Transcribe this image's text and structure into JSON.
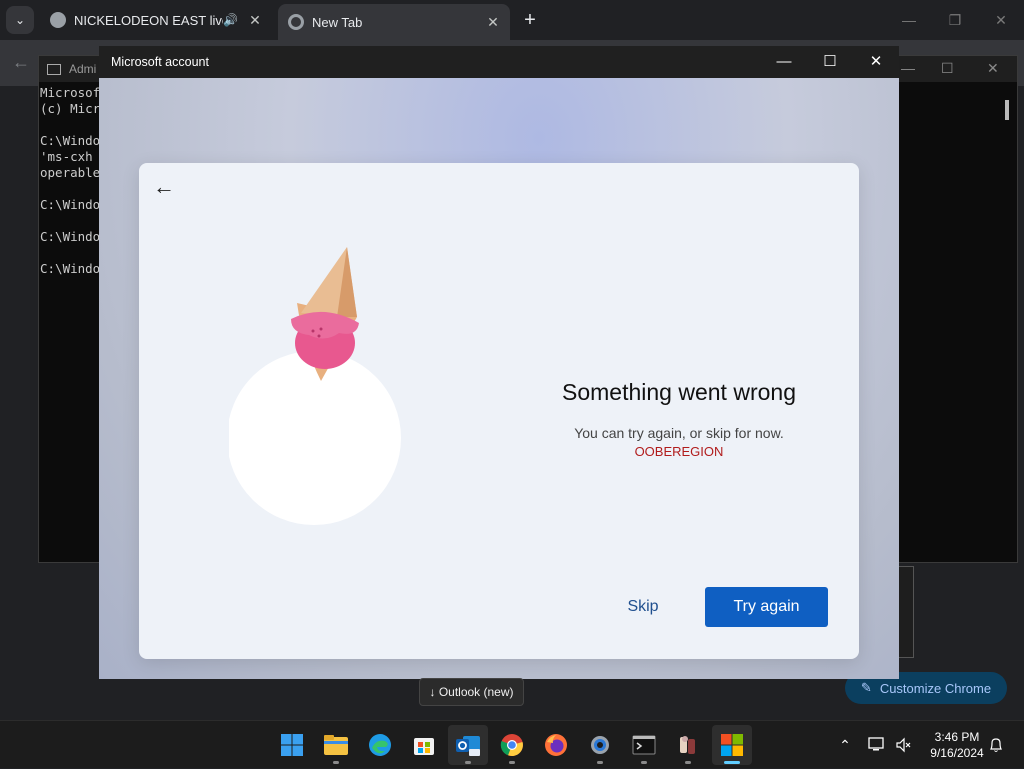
{
  "chrome": {
    "tabs": [
      {
        "title": "NICKELODEON EAST live str",
        "audio": "🔊"
      },
      {
        "title": "New Tab"
      }
    ],
    "tab_close": "✕",
    "new_tab": "+",
    "customize_label": "Customize Chrome"
  },
  "cmd": {
    "title": "Admi",
    "lines": "Microsof\n(c) Micr\n\nC:\\Windo\n'ms-cxh\noperable\n\nC:\\Windo\n\nC:\\Windo\n\nC:\\Windo"
  },
  "dialog": {
    "title": "Microsoft account",
    "back": "←",
    "heading": "Something went wrong",
    "subtitle": "You can try again, or skip for now.",
    "error_code": "OOBEREGION",
    "skip_label": "Skip",
    "try_again_label": "Try again"
  },
  "tooltip": "↓ Outlook (new)",
  "taskbar": {
    "apps": [
      "start-icon",
      "file-explorer-icon",
      "edge-icon",
      "store-icon",
      "outlook-new-icon",
      "chrome-icon",
      "firefox-icon",
      "settings-icon",
      "terminal-icon",
      "people-app-icon",
      "msa-window-icon"
    ],
    "time": "3:46 PM",
    "date": "9/16/2024"
  },
  "colors": {
    "accent": "#0f5fc2",
    "error": "#b11c1c"
  }
}
